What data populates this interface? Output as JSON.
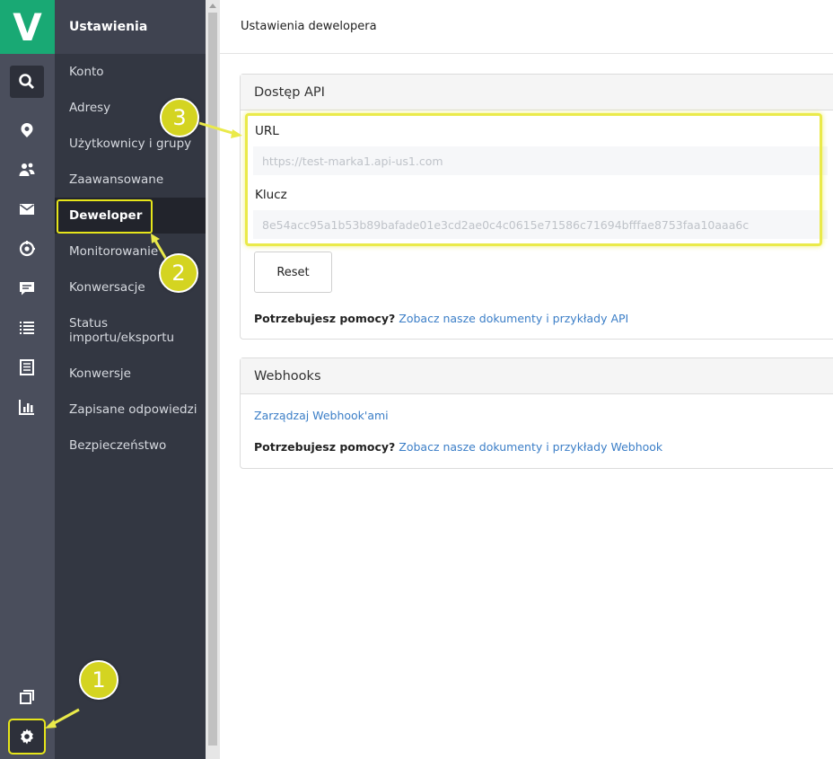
{
  "logo": {
    "letter": "V"
  },
  "sidebar": {
    "title": "Ustawienia",
    "items": [
      {
        "label": "Konto"
      },
      {
        "label": "Adresy"
      },
      {
        "label": "Użytkownicy i grupy"
      },
      {
        "label": "Zaawansowane"
      },
      {
        "label": "Deweloper",
        "active": true
      },
      {
        "label": "Monitorowanie"
      },
      {
        "label": "Konwersacje"
      },
      {
        "label": "Status importu/eksportu"
      },
      {
        "label": "Konwersje"
      },
      {
        "label": "Zapisane odpowiedzi"
      },
      {
        "label": "Bezpieczeństwo"
      }
    ]
  },
  "rail_icons": [
    "search-icon",
    "location-pin-icon",
    "contacts-icon",
    "envelope-icon",
    "automation-icon",
    "chat-icon",
    "list-icon",
    "document-icon",
    "bar-chart-icon",
    "pages-icon",
    "gear-icon"
  ],
  "page": {
    "title": "Ustawienia dewelopera"
  },
  "api_panel": {
    "title": "Dostęp API",
    "url_label": "URL",
    "url_value": "https://test-marka1.api-us1.com",
    "key_label": "Klucz",
    "key_value": "8e54acc95a1b53b89bafade01e3cd2ae0c4c0615e71586c71694bfffae8753faa10aaa6c",
    "reset_label": "Reset",
    "help_prefix": "Potrzebujesz pomocy?",
    "help_link": "Zobacz nasze dokumenty i przykłady API"
  },
  "webhooks_panel": {
    "title": "Webhooks",
    "manage_link": "Zarządzaj Webhook'ami",
    "help_prefix": "Potrzebujesz pomocy?",
    "help_link": "Zobacz nasze dokumenty i przykłady Webhook"
  },
  "callouts": {
    "one": "1",
    "two": "2",
    "three": "3"
  },
  "colors": {
    "accent_green": "#19a974",
    "highlight_yellow": "#e6e51a",
    "link_blue": "#3b7ec7"
  }
}
